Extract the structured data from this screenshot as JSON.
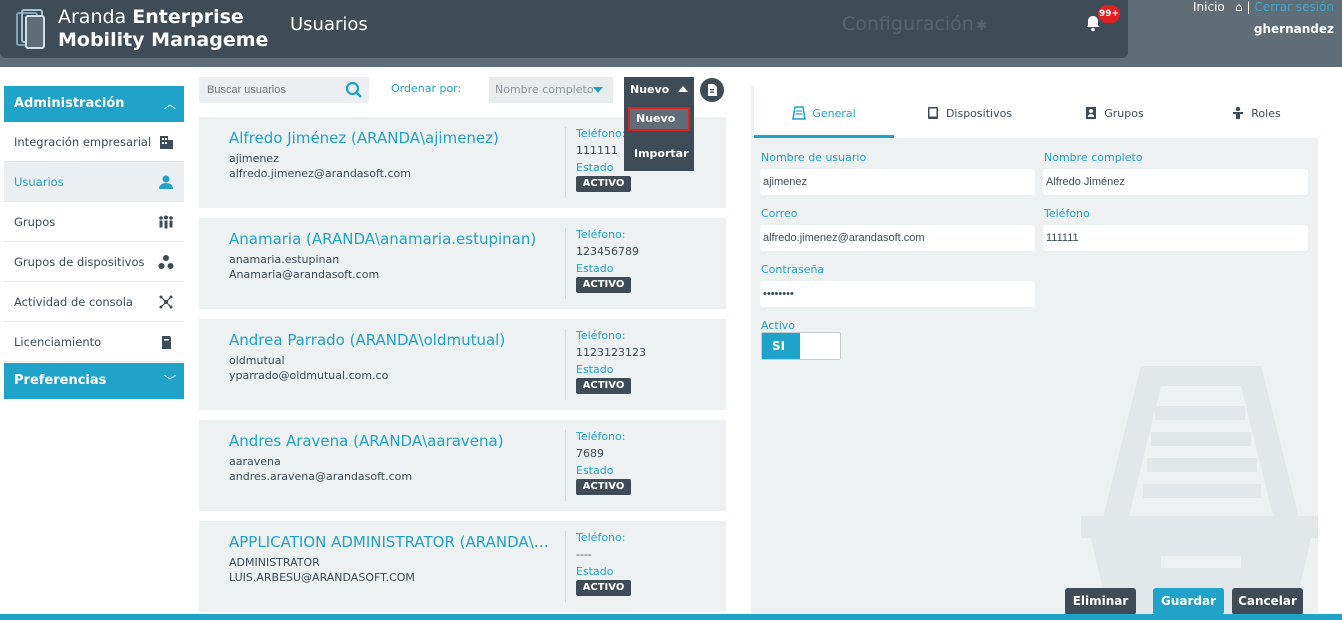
{
  "header": {
    "brand_line1_light": "Aranda",
    "brand_line1_bold": "Enterprise",
    "brand_line2": "Mobility Management",
    "page_title": "Usuarios",
    "config_label": "Configuración",
    "notifications_badge": "99+",
    "home_link": "Inicio",
    "separator": "|",
    "logout_link": "Cerrar sesión",
    "username": "ghernandez"
  },
  "sidebar": {
    "admin_section": "Administración",
    "items": [
      {
        "label": "Integración empresarial",
        "icon": "building-icon"
      },
      {
        "label": "Usuarios",
        "icon": "user-icon"
      },
      {
        "label": "Grupos",
        "icon": "group-icon"
      },
      {
        "label": "Grupos de dispositivos",
        "icon": "device-group-icon"
      },
      {
        "label": "Actividad de consola",
        "icon": "network-icon"
      },
      {
        "label": "Licenciamiento",
        "icon": "license-icon"
      }
    ],
    "prefs_section": "Preferencias"
  },
  "toolbar": {
    "search_placeholder": "Buscar usuarios",
    "sort_label": "Ordenar por:",
    "sort_value": "Nombre completo",
    "nuevo_label": "Nuevo",
    "menu": [
      "Nuevo",
      "Importar"
    ]
  },
  "users": [
    {
      "name": "Alfredo Jiménez (ARANDA\\ajimenez)",
      "login": "ajimenez",
      "email": "alfredo.jimenez@arandasoft.com",
      "phone_label": "Teléfono:",
      "phone": "111111",
      "state_label": "Estado",
      "status": "ACTIVO"
    },
    {
      "name": "Anamaria (ARANDA\\anamaria.estupinan)",
      "login": "anamaria.estupinan",
      "email": "Anamaria@arandasoft.com",
      "phone_label": "Teléfono:",
      "phone": "123456789",
      "state_label": "Estado",
      "status": "ACTIVO"
    },
    {
      "name": "Andrea Parrado (ARANDA\\oldmutual)",
      "login": "oldmutual",
      "email": "yparrado@oldmutual.com.co",
      "phone_label": "Teléfono:",
      "phone": "1123123123",
      "state_label": "Estado",
      "status": "ACTIVO"
    },
    {
      "name": "Andres Aravena (ARANDA\\aaravena)",
      "login": "aaravena",
      "email": "andres.aravena@arandasoft.com",
      "phone_label": "Teléfono:",
      "phone": "7689",
      "state_label": "Estado",
      "status": "ACTIVO"
    },
    {
      "name": "APPLICATION ADMINISTRATOR (ARANDA\\AD...",
      "login": "ADMINISTRATOR",
      "email": "LUIS.ARBESU@ARANDASOFT.COM",
      "phone_label": "Teléfono:",
      "phone": "----",
      "state_label": "Estado",
      "status": "ACTIVO"
    }
  ],
  "detail": {
    "tabs": [
      "General",
      "Dispositivos",
      "Grupos",
      "Roles"
    ],
    "fields": {
      "username_label": "Nombre de usuario",
      "username": "ajimenez",
      "fullname_label": "Nombre completo",
      "fullname": "Alfredo Jiménez",
      "email_label": "Correo",
      "email": "alfredo.jimenez@arandasoft.com",
      "phone_label": "Teléfono",
      "phone": "111111",
      "password_label": "Contraseña",
      "password": "••••••••",
      "active_label": "Activo",
      "active_value": "SI"
    },
    "buttons": {
      "delete": "Eliminar",
      "save": "Guardar",
      "cancel": "Cancelar"
    }
  },
  "colors": {
    "accent": "#1fa3c9",
    "dark": "#3e4c57",
    "badge": "#e02020"
  }
}
